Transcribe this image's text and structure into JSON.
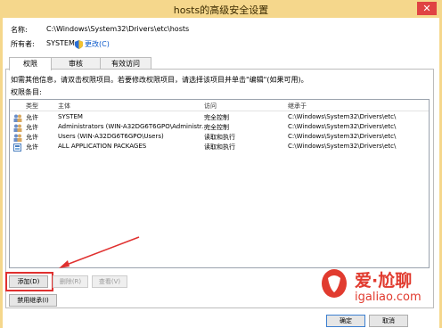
{
  "window": {
    "title": "hosts的高级安全设置",
    "close": "✕"
  },
  "name_label": "名称:",
  "name_value": "C:\\Windows\\System32\\Drivers\\etc\\hosts",
  "owner_label": "所有者:",
  "owner_value": "SYSTEM",
  "owner_change": "更改(C)",
  "tabs": [
    "权限",
    "审核",
    "有效访问"
  ],
  "info_text": "如需其他信息，请双击权限项目。若要修改权限项目，请选择该项目并单击\"编辑\"(如果可用)。",
  "entries_label": "权限条目:",
  "table": {
    "headers": [
      "类型",
      "主体",
      "访问",
      "继承于"
    ],
    "rows": [
      [
        "允许",
        "SYSTEM",
        "完全控制",
        "C:\\Windows\\System32\\Drivers\\etc\\"
      ],
      [
        "允许",
        "Administrators (WIN-A32DG6T6GPO\\Administr...",
        "完全控制",
        "C:\\Windows\\System32\\Drivers\\etc\\"
      ],
      [
        "允许",
        "Users (WIN-A32DG6T6GPO\\Users)",
        "读取和执行",
        "C:\\Windows\\System32\\Drivers\\etc\\"
      ],
      [
        "允许",
        "ALL APPLICATION PACKAGES",
        "读取和执行",
        "C:\\Windows\\System32\\Drivers\\etc\\"
      ]
    ]
  },
  "buttons": {
    "add": "添加(D)",
    "remove": "删除(R)",
    "view": "查看(V)",
    "disable_inherit": "禁用继承(I)",
    "ok": "确定",
    "cancel": "取消"
  },
  "watermark": {
    "brand": "爱·尬聊",
    "domain": "igaliao.com"
  },
  "colors": {
    "titlebar": "#f5d78c",
    "highlight": "#e0302f",
    "link": "#0a58ca"
  }
}
